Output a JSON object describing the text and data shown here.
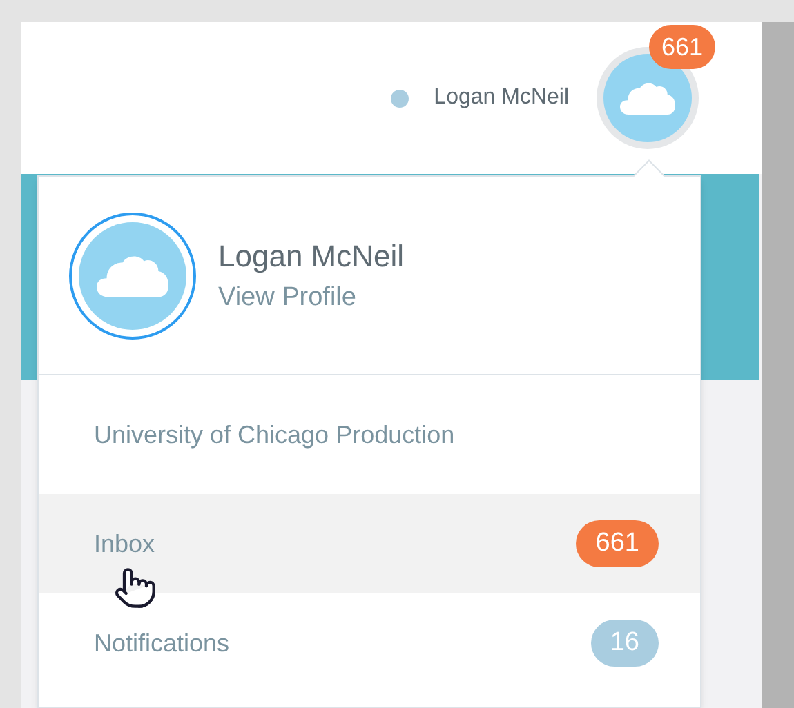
{
  "header": {
    "user_name": "Logan McNeil",
    "avatar_badge": "661"
  },
  "menu": {
    "name": "Logan McNeil",
    "link": "View Profile",
    "items": [
      {
        "label": "University of Chicago Production",
        "selected": false
      },
      {
        "label": "Inbox",
        "selected": true,
        "count": "661",
        "color": "#f47a42"
      },
      {
        "label": "Notifications",
        "selected": false,
        "count": "16",
        "color": "#a9cde0"
      }
    ]
  }
}
